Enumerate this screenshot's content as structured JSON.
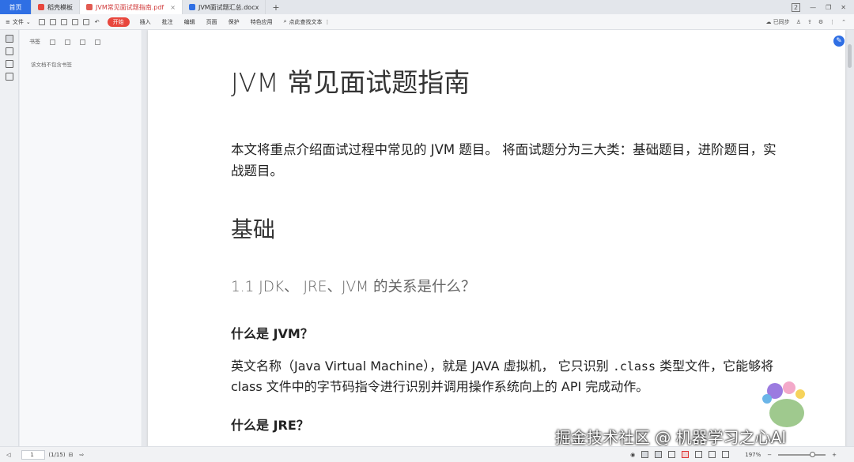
{
  "tabs": {
    "home": "首页",
    "items": [
      {
        "label": "稻壳模板"
      },
      {
        "label": "JVM常见面试题指南.pdf"
      },
      {
        "label": "JVM面试题汇总.docx"
      }
    ],
    "add": "+",
    "badge": "2"
  },
  "toolbar": {
    "file": "文件",
    "start": "开始",
    "menu": [
      "插入",
      "批注",
      "编辑",
      "页面",
      "保护",
      "特色应用"
    ],
    "search": "点此查找文本",
    "sync": "已同步"
  },
  "bookmarks": {
    "title": "书签",
    "empty": "该文档不包含书签"
  },
  "document": {
    "title": "JVM 常见面试题指南",
    "intro": "本文将重点介绍面试过程中常见的 JVM 题目。 将面试题分为三大类：基础题目，进阶题目，实战题目。",
    "section": "基础",
    "q1": "1.1 JDK、 JRE、JVM 的关系是什么？",
    "q1a": "什么是 JVM？",
    "para_a": "英文名称（Java Virtual Machine），就是 JAVA 虚拟机， 它只识别 ",
    "para_code": ".class",
    "para_b": " 类型文件，它能够将 class 文件中的字节码指令进行识别并调用操作系统向上的 API 完成动作。",
    "q1b": "什么是 JRE？"
  },
  "watermark": "掘金技术社区 @ 机器学习之心AI",
  "status": {
    "page": "1",
    "total": "(1/15)",
    "zoom": "197%"
  },
  "colors": {
    "accent": "#2f6fe4",
    "start": "#e8473d"
  }
}
